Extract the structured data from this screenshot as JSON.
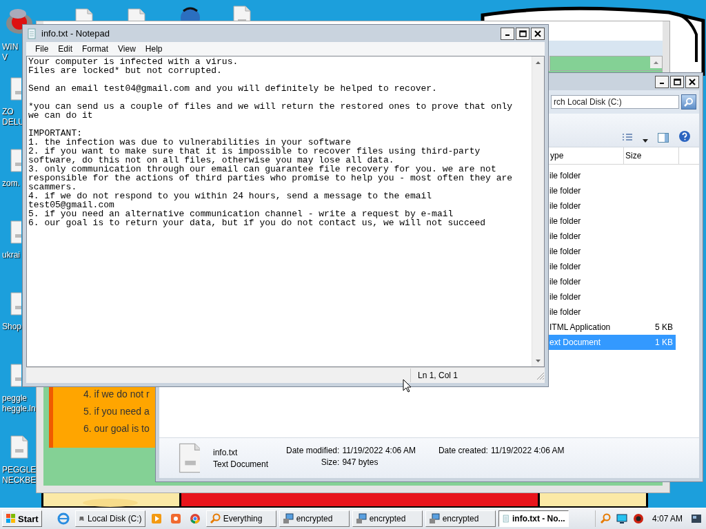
{
  "desktop_icons": [
    {
      "kind": "app",
      "lines": [
        "WIN",
        "V"
      ]
    },
    {
      "kind": "file",
      "lines": [
        "ZO",
        "DELU"
      ]
    },
    {
      "kind": "file",
      "lines": [
        "zom."
      ]
    },
    {
      "kind": "file",
      "lines": [
        "ukrai"
      ]
    },
    {
      "kind": "file",
      "lines": [
        "Shop"
      ]
    },
    {
      "kind": "file",
      "lines": [
        "peggle",
        "heggle.ln"
      ]
    },
    {
      "kind": "file",
      "lines": [
        "PEGGLE",
        "NECKBE"
      ]
    }
  ],
  "note_window": {
    "list_items": [
      "4. if we do not r",
      "5. if you need a",
      "6. our goal is to"
    ]
  },
  "explorer": {
    "search": {
      "placeholder": "rch Local Disk (C:)"
    },
    "columns": [
      "ype",
      "Size"
    ],
    "rows": [
      {
        "type": "ile folder",
        "selected": false
      },
      {
        "type": "ile folder",
        "selected": false
      },
      {
        "type": "ile folder",
        "selected": false
      },
      {
        "type": "ile folder",
        "selected": false
      },
      {
        "type": "ile folder",
        "selected": false
      },
      {
        "type": "ile folder",
        "selected": false
      },
      {
        "type": "ile folder",
        "selected": false
      },
      {
        "type": "ile folder",
        "selected": false
      },
      {
        "type": "ile folder",
        "selected": false
      },
      {
        "type": "ile folder",
        "selected": false
      },
      {
        "type": "ITML Application",
        "size": "5 KB",
        "selected": false
      },
      {
        "type": "ext Document",
        "size": "1 KB",
        "selected": true
      }
    ],
    "details": {
      "name": "info.txt",
      "type": "Text Document",
      "modified_label": "Date modified:",
      "modified": "11/19/2022 4:06 AM",
      "size_label": "Size:",
      "size": "947 bytes",
      "created_label": "Date created:",
      "created": "11/19/2022 4:06 AM"
    }
  },
  "notepad": {
    "title": "info.txt - Notepad",
    "menu": [
      "File",
      "Edit",
      "Format",
      "View",
      "Help"
    ],
    "text": "Your computer is infected with a virus.\nFiles are locked* but not corrupted.\n\nSend an email test04@gmail.com and you will definitely be helped to recover.\n\n*you can send us a couple of files and we will return the restored ones to prove that only we can do it\n\nIMPORTANT:\n1. the infection was due to vulnerabilities in your software\n2. if you want to make sure that it is impossible to recover files using third-party software, do this not on all files, otherwise you may lose all data.\n3. only communication through our email can guarantee file recovery for you. we are not responsible for the actions of third parties who promise to help you - most often they are scammers.\n4. if we do not respond to you within 24 hours, send a message to the email test05@gmail.com\n5. if you need an alternative communication channel - write a request by e-mail\n6. our goal is to return your data, but if you do not contact us, we will not succeed",
    "status": "Ln 1, Col 1"
  },
  "taskbar": {
    "start": "Start",
    "buttons": [
      {
        "kind": "drive",
        "label": "Local Disk (C:)",
        "selected": false
      },
      {
        "kind": "search",
        "label": "Everything",
        "selected": false
      },
      {
        "kind": "program",
        "label": "encrypted",
        "selected": false
      },
      {
        "kind": "program",
        "label": "encrypted",
        "selected": false
      },
      {
        "kind": "program",
        "label": "encrypted",
        "selected": false
      },
      {
        "kind": "notepad",
        "label": "info.txt - No...",
        "selected": true
      }
    ],
    "time": "4:07 AM"
  }
}
